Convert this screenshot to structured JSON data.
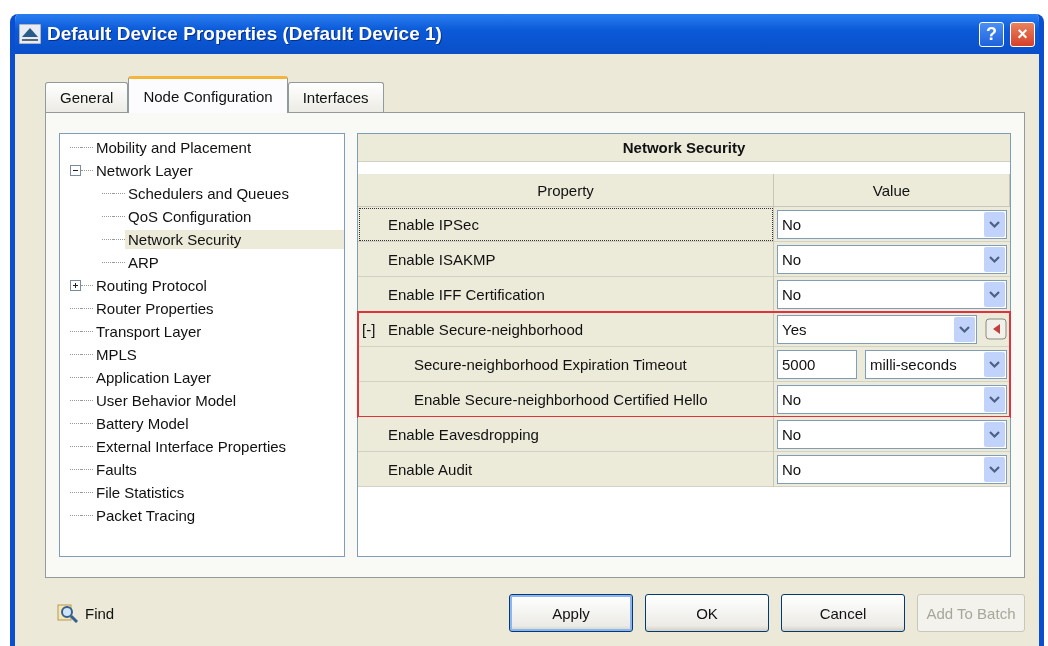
{
  "window": {
    "title": "Default Device Properties (Default Device 1)"
  },
  "title_buttons": [
    {
      "kind": "help",
      "label": "?"
    },
    {
      "kind": "close",
      "label": "×"
    }
  ],
  "tabs": [
    {
      "label": "General",
      "selected": false
    },
    {
      "label": "Node Configuration",
      "selected": true
    },
    {
      "label": "Interfaces",
      "selected": false
    }
  ],
  "tree": [
    {
      "label": "Mobility and Placement",
      "selected": false
    },
    {
      "label": "Network Layer",
      "selected": false,
      "expanded": true,
      "children": [
        {
          "label": "Schedulers and Queues",
          "selected": false
        },
        {
          "label": "QoS Configuration",
          "selected": false
        },
        {
          "label": "Network Security",
          "selected": true
        },
        {
          "label": "ARP",
          "selected": false
        }
      ]
    },
    {
      "label": "Routing Protocol",
      "selected": false,
      "expanded": false
    },
    {
      "label": "Router Properties",
      "selected": false
    },
    {
      "label": "Transport Layer",
      "selected": false
    },
    {
      "label": "MPLS",
      "selected": false
    },
    {
      "label": "Application Layer",
      "selected": false
    },
    {
      "label": "User Behavior Model",
      "selected": false
    },
    {
      "label": "Battery Model",
      "selected": false
    },
    {
      "label": "External Interface Properties",
      "selected": false
    },
    {
      "label": "Faults",
      "selected": false
    },
    {
      "label": "File Statistics",
      "selected": false
    },
    {
      "label": "Packet Tracing",
      "selected": false
    }
  ],
  "panel": {
    "title": "Network Security",
    "columns": [
      "Property",
      "Value"
    ],
    "rows": [
      {
        "kind": "select",
        "property": "Enable IPSec",
        "value": "No",
        "focused": true
      },
      {
        "kind": "select",
        "property": "Enable ISAKMP",
        "value": "No",
        "focused": false
      },
      {
        "kind": "select",
        "property": "Enable IFF Certification",
        "value": "No",
        "focused": false
      },
      {
        "kind": "select",
        "property": "Enable Secure-neighborhood",
        "toggle": "[-]",
        "value": "Yes",
        "focused": false,
        "highlighted": true,
        "children": [
          {
            "kind": "number_unit",
            "property": "Secure-neighborhood Expiration Timeout",
            "value": "5000",
            "unit": "milli-seconds",
            "focused": false
          },
          {
            "kind": "select",
            "property": "Enable Secure-neighborhood Certified Hello",
            "value": "No",
            "focused": false
          }
        ]
      },
      {
        "kind": "select",
        "property": "Enable Eavesdropping",
        "value": "No",
        "focused": false
      },
      {
        "kind": "select",
        "property": "Enable Audit",
        "value": "No",
        "focused": false
      }
    ]
  },
  "find": {
    "label": "Find"
  },
  "buttons": [
    {
      "label": "Apply",
      "default": true,
      "disabled": false
    },
    {
      "label": "OK",
      "default": false,
      "disabled": false
    },
    {
      "label": "Cancel",
      "default": false,
      "disabled": false
    },
    {
      "label": "Add To Batch",
      "default": false,
      "disabled": true
    }
  ]
}
